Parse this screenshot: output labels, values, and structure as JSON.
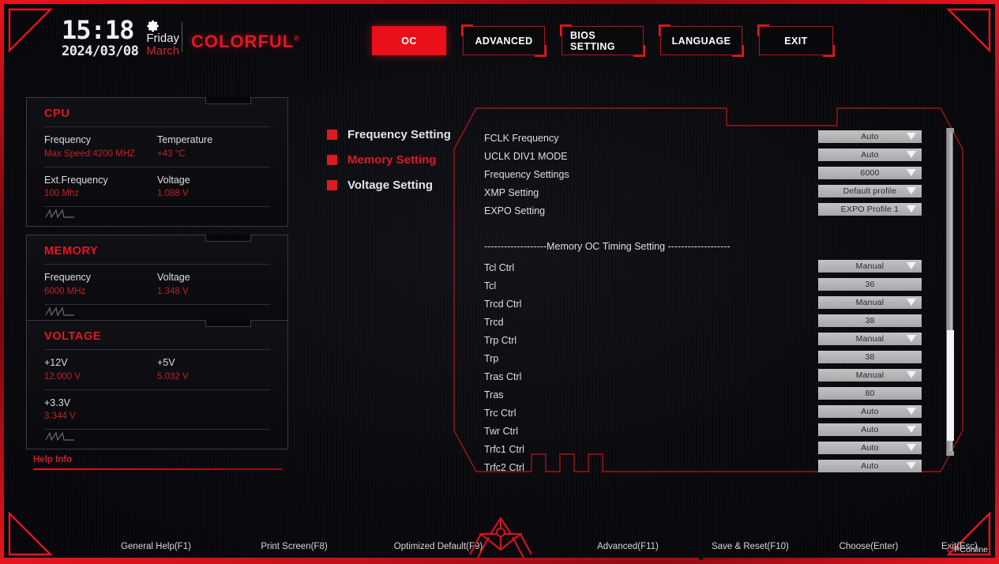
{
  "header": {
    "time": "15:18",
    "date": "2024/03/08",
    "day": "Friday",
    "month": "March",
    "brand": "COLORFUL",
    "brand_mark": "®",
    "gear_icon": "gear-icon"
  },
  "tabs": [
    {
      "label": "OC",
      "active": true
    },
    {
      "label": "ADVANCED",
      "active": false
    },
    {
      "label": "BIOS SETTING",
      "active": false
    },
    {
      "label": "LANGUAGE",
      "active": false
    },
    {
      "label": "EXIT",
      "active": false
    }
  ],
  "cards": [
    {
      "title": "CPU",
      "rows": [
        [
          {
            "key": "Frequency",
            "value": "Max Speed:4200 MHZ"
          },
          {
            "key": "Temperature",
            "value": "+43 °C"
          }
        ],
        [
          {
            "key": "Ext.Frequency",
            "value": "100 Mhz"
          },
          {
            "key": "Voltage",
            "value": "1.088 V"
          }
        ]
      ]
    },
    {
      "title": "MEMORY",
      "rows": [
        [
          {
            "key": "Frequency",
            "value": "6000 MHz"
          },
          {
            "key": "Voltage",
            "value": "1.348 V"
          }
        ]
      ]
    },
    {
      "title": "VOLTAGE",
      "rows": [
        [
          {
            "key": "+12V",
            "value": "12.000 V"
          },
          {
            "key": "+5V",
            "value": "5.032 V"
          }
        ],
        [
          {
            "key": "+3.3V",
            "value": "3.344 V"
          },
          {
            "key": "",
            "value": ""
          }
        ]
      ]
    }
  ],
  "help": {
    "label": "Help Info",
    "text": ""
  },
  "menu": [
    {
      "label": "Frequency Setting",
      "selected": false
    },
    {
      "label": "Memory Setting",
      "selected": true
    },
    {
      "label": "Voltage Setting",
      "selected": false
    }
  ],
  "settings": [
    {
      "label": "FCLK Frequency",
      "value": "Auto",
      "type": "dropdown"
    },
    {
      "label": "UCLK DIV1 MODE",
      "value": "Auto",
      "type": "dropdown"
    },
    {
      "label": "Frequency Settings",
      "value": "6000",
      "type": "dropdown"
    },
    {
      "label": "XMP Setting",
      "value": "Default profile",
      "type": "dropdown"
    },
    {
      "label": "EXPO Setting",
      "value": "EXPO Profile 1",
      "type": "dropdown"
    },
    {
      "label": "-------------------Memory OC Timing Setting -------------------",
      "value": "",
      "type": "separator"
    },
    {
      "label": "Tcl Ctrl",
      "value": "Manual",
      "type": "dropdown"
    },
    {
      "label": "Tcl",
      "value": "36",
      "type": "field"
    },
    {
      "label": "Trcd Ctrl",
      "value": "Manual",
      "type": "dropdown"
    },
    {
      "label": "Trcd",
      "value": "38",
      "type": "field"
    },
    {
      "label": "Trp Ctrl",
      "value": "Manual",
      "type": "dropdown"
    },
    {
      "label": "Trp",
      "value": "38",
      "type": "field"
    },
    {
      "label": "Tras Ctrl",
      "value": "Manual",
      "type": "dropdown"
    },
    {
      "label": "Tras",
      "value": "80",
      "type": "field"
    },
    {
      "label": "Trc Ctrl",
      "value": "Auto",
      "type": "dropdown"
    },
    {
      "label": "Twr Ctrl",
      "value": "Auto",
      "type": "dropdown"
    },
    {
      "label": "Trfc1 Ctrl",
      "value": "Auto",
      "type": "dropdown"
    },
    {
      "label": "Trfc2 Ctrl",
      "value": "Auto",
      "type": "dropdown"
    }
  ],
  "footer": {
    "keys": [
      "General Help(F1)",
      "Print Screen(F8)",
      "Optimized Default(F9)",
      "Advanced(F11)",
      "Save & Reset(F10)",
      "Choose(Enter)",
      "Exit(Esc)"
    ],
    "watermark_mark": "C",
    "watermark": "PConline"
  },
  "colors": {
    "accent_red": "#e8141e",
    "tab_active": "#ea1019",
    "value_red": "#bf2028",
    "text_light": "#dedee3",
    "widget_face": "#b8b8bb",
    "panel_bg": "#0a0a0e"
  }
}
